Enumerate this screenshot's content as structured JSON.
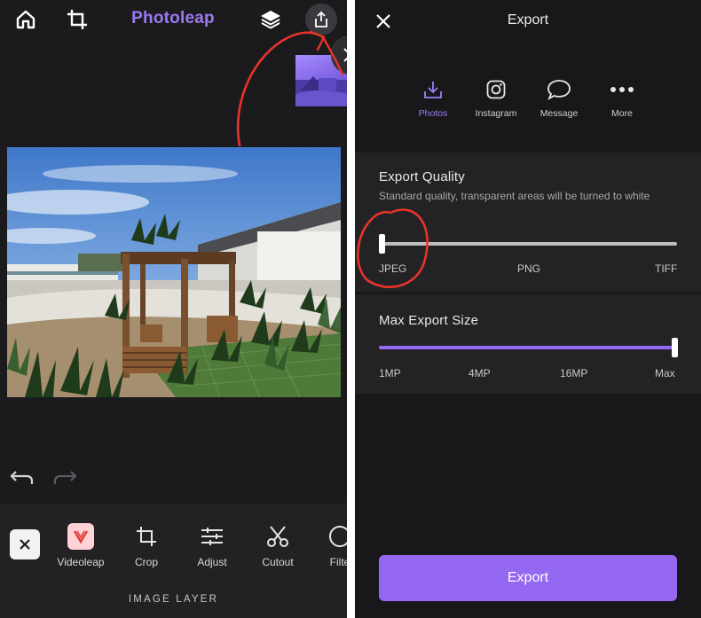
{
  "editor": {
    "app_title": "Photoleap",
    "icons": {
      "home": "home-icon",
      "crop": "crop-icon",
      "layers": "layers-icon",
      "share": "share-icon",
      "close": "close-icon",
      "undo": "undo-icon",
      "redo": "redo-icon"
    },
    "tools": [
      {
        "label": "Videoleap",
        "icon": "videoleap-icon"
      },
      {
        "label": "Crop",
        "icon": "crop-icon"
      },
      {
        "label": "Adjust",
        "icon": "adjust-sliders-icon"
      },
      {
        "label": "Cutout",
        "icon": "scissors-icon"
      },
      {
        "label": "Filte",
        "icon": "filters-icon"
      }
    ],
    "section_label": "IMAGE LAYER"
  },
  "export": {
    "title": "Export",
    "destinations": [
      {
        "label": "Photos",
        "icon": "download-icon",
        "active": true
      },
      {
        "label": "Instagram",
        "icon": "instagram-icon",
        "active": false
      },
      {
        "label": "Message",
        "icon": "message-bubble-icon",
        "active": false
      },
      {
        "label": "More",
        "icon": "more-dots-icon",
        "active": false
      }
    ],
    "quality": {
      "title": "Export Quality",
      "description": "Standard quality, transparent areas will be turned to white",
      "options": [
        "JPEG",
        "PNG",
        "TIFF"
      ],
      "selected": "JPEG"
    },
    "size": {
      "title": "Max Export Size",
      "options": [
        "1MP",
        "4MP",
        "16MP",
        "Max"
      ],
      "selected": "Max"
    },
    "export_button": "Export"
  },
  "colors": {
    "accent": "#9468f0",
    "brand_title": "#9c78f2",
    "annotation": "#e8332a",
    "background": "#18181a"
  }
}
